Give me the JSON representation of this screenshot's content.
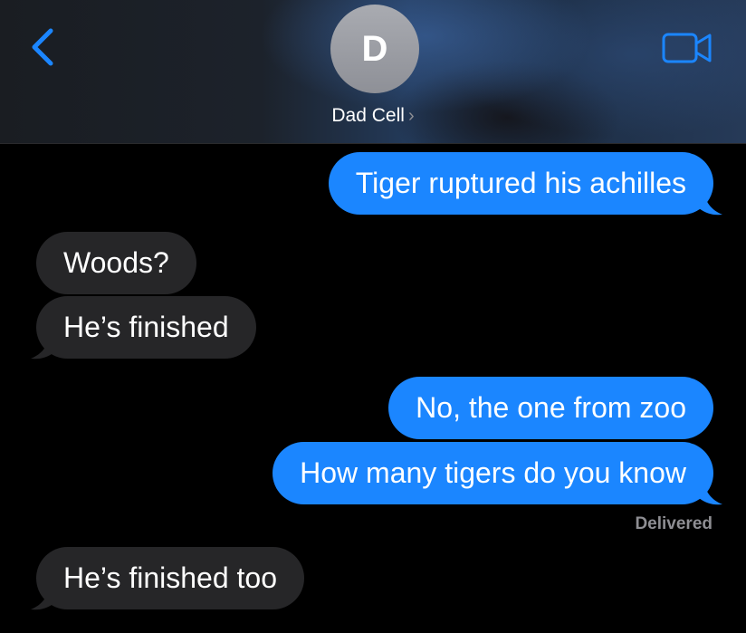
{
  "header": {
    "avatar_initial": "D",
    "contact_name": "Dad Cell",
    "chevron": "›",
    "back_icon": "chevron-left-icon",
    "video_icon": "video-camera-icon",
    "accent_color": "#1b86ff"
  },
  "messages": [
    {
      "from": "me",
      "text": "Tiger ruptured his achilles"
    },
    {
      "from": "dad",
      "text": "Woods?"
    },
    {
      "from": "dad",
      "text": "He’s finished"
    },
    {
      "from": "me",
      "text": "No, the one from zoo"
    },
    {
      "from": "me",
      "text": "How many tigers do you know"
    },
    {
      "from": "dad",
      "text": "He’s finished too"
    }
  ],
  "status": {
    "delivered": "Delivered"
  },
  "colors": {
    "sent_bubble": "#1b86ff",
    "received_bubble": "#262628",
    "background": "#000000"
  }
}
